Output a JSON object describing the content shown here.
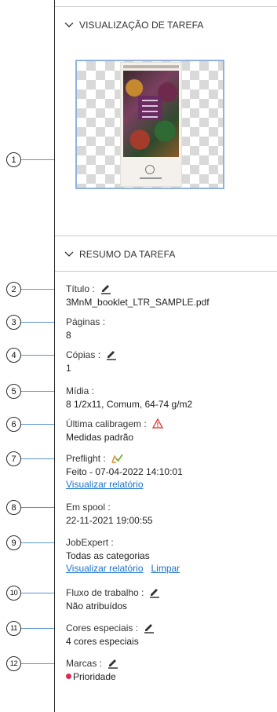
{
  "preview_section": {
    "title": "VISUALIZAÇÃO DE TAREFA",
    "chevron_icon": "chevron-down-icon"
  },
  "summary_section": {
    "title": "RESUMO DA TAREFA",
    "chevron_icon": "chevron-down-icon"
  },
  "callouts": [
    "1",
    "2",
    "3",
    "4",
    "5",
    "6",
    "7",
    "8",
    "9",
    "10",
    "11",
    "12"
  ],
  "fields": {
    "title": {
      "label": "Título :",
      "value": "3MnM_booklet_LTR_SAMPLE.pdf",
      "icon": "pencil-icon"
    },
    "pages": {
      "label": "Páginas :",
      "value": "8"
    },
    "copies": {
      "label": "Cópias :",
      "value": "1",
      "icon": "pencil-icon"
    },
    "media": {
      "label": "Mídia :",
      "value": "8 1/2x11, Comum, 64-74 g/m2"
    },
    "calibration": {
      "label": "Última calibragem :",
      "value": "Medidas padrão",
      "icon": "warning-icon"
    },
    "preflight": {
      "label": "Preflight :",
      "value": "Feito - 07-04-2022 14:10:01",
      "link": "Visualizar relatório",
      "icon": "preflight-check-icon"
    },
    "spool": {
      "label": "Em spool :",
      "value": "22-11-2021 19:00:55"
    },
    "jobexpert": {
      "label": "JobExpert :",
      "value": "Todas as categorias",
      "link": "Visualizar relatório",
      "link2": "Limpar"
    },
    "workflow": {
      "label": "Fluxo de trabalho :",
      "value": "Não atribuídos",
      "icon": "pencil-icon"
    },
    "spot_colors": {
      "label": "Cores especiais :",
      "value": "4 cores especiais",
      "icon": "pencil-icon"
    },
    "marks": {
      "label": "Marcas :",
      "value": "Prioridade",
      "icon": "pencil-icon",
      "dot_color": "#e0284f"
    }
  },
  "colors": {
    "accent_link": "#1a73c9",
    "leader_line": "#5b95d2",
    "preview_border": "#8fb3de",
    "warning": "#d9342b",
    "preflight": "#e08a1e"
  }
}
